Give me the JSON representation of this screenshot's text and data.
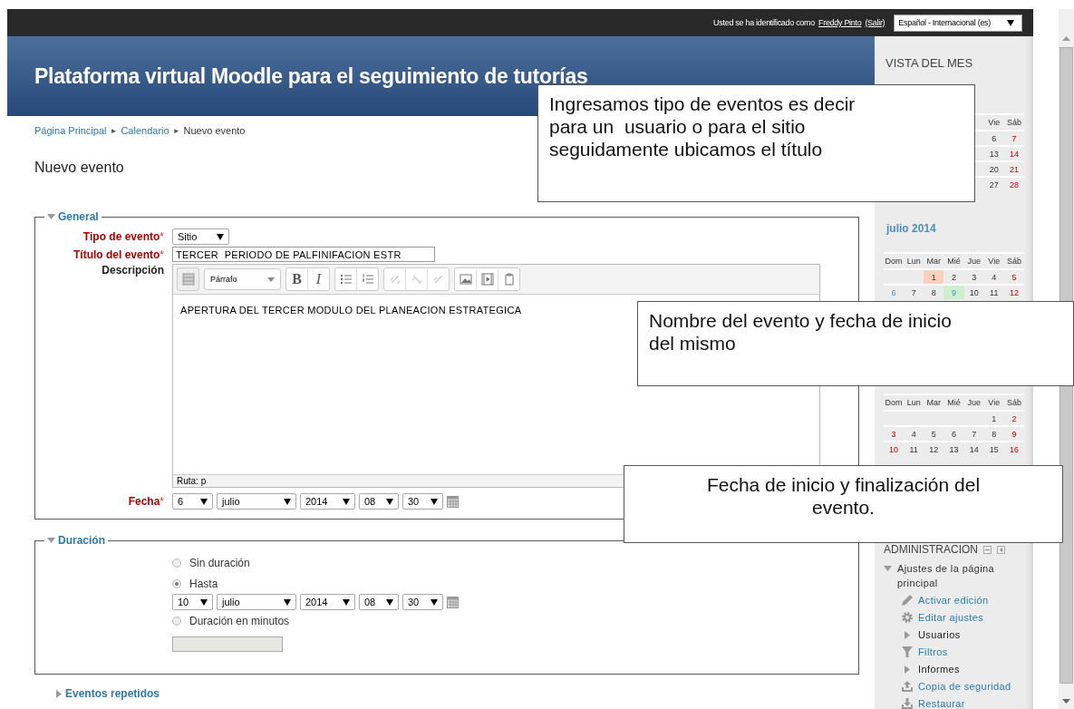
{
  "login_bar": {
    "prefix": "Usted se ha identificado como",
    "user": "Freddy Pinto",
    "logout": "(Salir)",
    "language": "Español - Internacional (es)"
  },
  "header": {
    "title": "Plataforma virtual Moodle para el seguimiento de tutorías"
  },
  "breadcrumb": {
    "items": [
      "Página Principal",
      "Calendario",
      "Nuevo evento"
    ],
    "separators": [
      "►",
      "►"
    ]
  },
  "page_title": "Nuevo evento",
  "general": {
    "legend": "General",
    "expanded": true,
    "event_type": {
      "label": "Tipo de evento",
      "required_mark": "*",
      "value": "Sitio"
    },
    "event_title": {
      "label": "Título del evento",
      "required_mark": "*",
      "value": "TERCER  PERIODO DE PALFINIFACION ESTR"
    },
    "description": {
      "label": "Descripción",
      "format": "Párrafo",
      "bold": "B",
      "italic": "I",
      "content": "APERTURA DEL TERCER MODULO DEL PLANEACION ESTRATEGICA",
      "path": "Ruta: p"
    },
    "date": {
      "label": "Fecha",
      "required_mark": "*",
      "selects": [
        "6",
        "julio",
        "2014",
        "08",
        "30"
      ]
    }
  },
  "duration": {
    "legend": "Duración",
    "expanded": true,
    "options": [
      {
        "label": "Sin duración",
        "selected": false
      },
      {
        "label": "Hasta",
        "selected": true,
        "selects": [
          "10",
          "julio",
          "2014",
          "08",
          "30"
        ]
      },
      {
        "label": "Duración en minutos",
        "selected": false
      }
    ],
    "minutes_field": {
      "disabled": true
    }
  },
  "repeat": {
    "legend": "Eventos repetidos",
    "expanded": false
  },
  "month_view": {
    "title": "VISTA DEL MES",
    "calendars": [
      {
        "header": [
          {
            "kind": "empty"
          },
          {
            "kind": "empty"
          },
          {
            "kind": "empty"
          },
          {
            "kind": "empty"
          },
          {
            "kind": "empty"
          },
          {
            "label": "Vie",
            "kind": "label"
          },
          {
            "label": "Sáb",
            "kind": "label"
          }
        ],
        "weeks": [
          [
            {
              "kind": "empty"
            },
            {
              "kind": "empty"
            },
            {
              "kind": "empty"
            },
            {
              "kind": "empty"
            },
            {
              "kind": "empty"
            },
            {
              "day": "6",
              "kind": "day"
            },
            {
              "day": "7",
              "kind": "weekend"
            }
          ],
          [
            {
              "kind": "empty"
            },
            {
              "kind": "empty"
            },
            {
              "kind": "empty"
            },
            {
              "kind": "empty"
            },
            {
              "kind": "empty"
            },
            {
              "day": "13",
              "kind": "day"
            },
            {
              "day": "14",
              "kind": "weekend"
            }
          ],
          [
            {
              "kind": "empty"
            },
            {
              "kind": "empty"
            },
            {
              "kind": "empty"
            },
            {
              "kind": "empty"
            },
            {
              "kind": "empty"
            },
            {
              "day": "20",
              "kind": "day"
            },
            {
              "day": "21",
              "kind": "weekend"
            }
          ],
          [
            {
              "kind": "empty"
            },
            {
              "kind": "empty"
            },
            {
              "kind": "empty"
            },
            {
              "kind": "empty"
            },
            {
              "kind": "empty"
            },
            {
              "day": "27",
              "kind": "day"
            },
            {
              "day": "28",
              "kind": "weekend"
            }
          ]
        ]
      },
      {
        "title": "julio 2014",
        "header": [
          {
            "label": "Dom",
            "kind": "label"
          },
          {
            "label": "Lun",
            "kind": "label"
          },
          {
            "label": "Mar",
            "kind": "label"
          },
          {
            "label": "Mié",
            "kind": "label"
          },
          {
            "label": "Jue",
            "kind": "label"
          },
          {
            "label": "Vie",
            "kind": "label"
          },
          {
            "label": "Sáb",
            "kind": "label"
          }
        ],
        "weeks": [
          [
            {
              "kind": "empty"
            },
            {
              "kind": "empty"
            },
            {
              "day": "1",
              "kind": "today"
            },
            {
              "day": "2",
              "kind": "day"
            },
            {
              "day": "3",
              "kind": "day"
            },
            {
              "day": "4",
              "kind": "day"
            },
            {
              "day": "5",
              "kind": "weekend"
            }
          ],
          [
            {
              "day": "6",
              "kind": "event"
            },
            {
              "day": "7",
              "kind": "day"
            },
            {
              "day": "8",
              "kind": "day"
            },
            {
              "day": "9",
              "kind": "selected"
            },
            {
              "day": "10",
              "kind": "day"
            },
            {
              "day": "11",
              "kind": "day"
            },
            {
              "day": "12",
              "kind": "weekend"
            }
          ]
        ]
      },
      {
        "header": [
          {
            "label": "Dom",
            "kind": "label"
          },
          {
            "label": "Lun",
            "kind": "label"
          },
          {
            "label": "Mar",
            "kind": "label"
          },
          {
            "label": "Mié",
            "kind": "label"
          },
          {
            "label": "Jue",
            "kind": "label"
          },
          {
            "label": "Vie",
            "kind": "label"
          },
          {
            "label": "Sáb",
            "kind": "label"
          }
        ],
        "weeks": [
          [
            {
              "kind": "empty"
            },
            {
              "kind": "empty"
            },
            {
              "kind": "empty"
            },
            {
              "kind": "empty"
            },
            {
              "kind": "empty"
            },
            {
              "day": "1",
              "kind": "day"
            },
            {
              "day": "2",
              "kind": "weekend"
            }
          ],
          [
            {
              "day": "3",
              "kind": "weekend"
            },
            {
              "day": "4",
              "kind": "day"
            },
            {
              "day": "5",
              "kind": "day"
            },
            {
              "day": "6",
              "kind": "day"
            },
            {
              "day": "7",
              "kind": "day"
            },
            {
              "day": "8",
              "kind": "day"
            },
            {
              "day": "9",
              "kind": "weekend"
            }
          ],
          [
            {
              "day": "10",
              "kind": "weekend"
            },
            {
              "day": "11",
              "kind": "day"
            },
            {
              "day": "12",
              "kind": "day"
            },
            {
              "day": "13",
              "kind": "day"
            },
            {
              "day": "14",
              "kind": "day"
            },
            {
              "day": "15",
              "kind": "day"
            },
            {
              "day": "16",
              "kind": "weekend"
            }
          ]
        ]
      }
    ]
  },
  "administration": {
    "title": "ADMINISTRACION",
    "tree": [
      {
        "label": "Ajustes de la página principal",
        "expanded": true,
        "children": [
          {
            "label": "Activar edición",
            "kind": "pencil"
          },
          {
            "label": "Editar ajustes",
            "kind": "gear"
          },
          {
            "label": "Usuarios",
            "kind": "branch",
            "expanded": false
          },
          {
            "label": "Filtros",
            "kind": "filter"
          },
          {
            "label": "Informes",
            "kind": "branch",
            "expanded": false
          },
          {
            "label": "Copia de seguridad",
            "kind": "upload"
          },
          {
            "label": "Restaurar",
            "kind": "download"
          }
        ]
      }
    ]
  },
  "callouts": [
    {
      "text": "Ingresamos tipo de eventos es decir\npara un  usuario o para el sitio\nseguidamente ubicamos el título"
    },
    {
      "text": "Nombre del evento y fecha de inicio\ndel mismo"
    },
    {
      "text": "Fecha de inicio y finalización del\nevento."
    }
  ]
}
